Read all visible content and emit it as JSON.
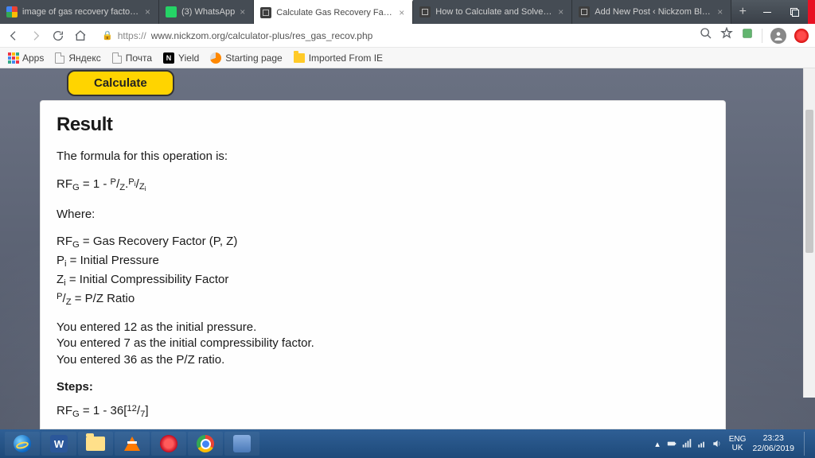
{
  "tabs": [
    {
      "label": "image of gas recovery factor - G",
      "fav": "google"
    },
    {
      "label": "(3) WhatsApp",
      "fav": "wa"
    },
    {
      "label": "Calculate Gas Recovery Factor (P",
      "fav": "gen",
      "active": true
    },
    {
      "label": "How to Calculate and Solve for t",
      "fav": "gen"
    },
    {
      "label": "Add New Post ‹ Nickzom Blog –",
      "fav": "gen"
    }
  ],
  "url": {
    "scheme": "https://",
    "rest": "www.nickzom.org/calculator-plus/res_gas_recov.php"
  },
  "bookmarks": {
    "apps": "Apps",
    "items": [
      {
        "icon": "doc",
        "label": "Яндекс"
      },
      {
        "icon": "doc",
        "label": "Почта"
      },
      {
        "icon": "n",
        "label": "Yield"
      },
      {
        "icon": "s",
        "label": "Starting page"
      },
      {
        "icon": "f",
        "label": "Imported From IE"
      }
    ]
  },
  "buttons": {
    "calculate": "Calculate"
  },
  "result": {
    "heading": "Result",
    "intro": "The formula for this operation is:",
    "where": "Where:",
    "defs": {
      "rfg": "Gas Recovery Factor (P, Z)",
      "pi": "Initial Pressure",
      "zi": "Initial Compressibility Factor",
      "pz": "P/Z Ratio"
    },
    "entered": {
      "l1": "You entered 12 as the initial pressure.",
      "l2": "You entered 7 as the initial compressibility factor.",
      "l3": "You entered 36 as the P/Z ratio."
    },
    "steps": "Steps:"
  },
  "inputs": {
    "initial_pressure": 12,
    "initial_compressibility": 7,
    "pz_ratio": 36
  },
  "system": {
    "lang1": "ENG",
    "lang2": "UK",
    "time": "23:23",
    "date": "22/06/2019"
  }
}
